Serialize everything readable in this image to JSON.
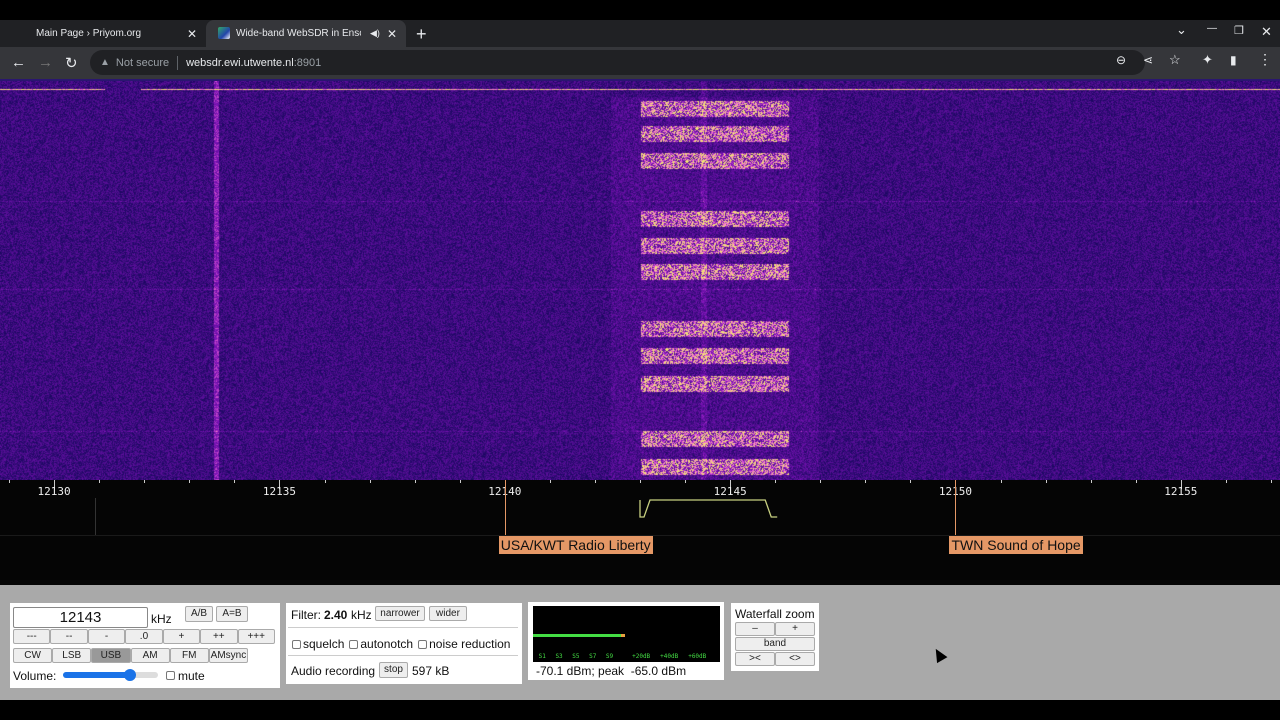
{
  "browser": {
    "tabs": [
      {
        "title": "Main Page › Priyom.org",
        "active": false
      },
      {
        "title": "Wide-band WebSDR in Enschede",
        "active": true,
        "audio": true
      }
    ],
    "new_tab_label": "+",
    "url": {
      "security": "Not secure",
      "host": "websdr.ewi.utwente.nl",
      "port": ":8901"
    },
    "icons": {
      "back": "←",
      "forward": "→",
      "reload": "↻",
      "zoom": "⊖",
      "share": "⋖",
      "star": "☆",
      "extensions": "✦",
      "sidepanel": "▮",
      "menu": "⋮",
      "tabsearch": "⌄",
      "minimize": "—",
      "restore": "❐",
      "close": "✕",
      "tabclose": "✕",
      "audio": "🔈"
    }
  },
  "scale": {
    "unit": "kHz",
    "range_khz": [
      12128.8,
      12157.2
    ],
    "major_ticks": [
      12130,
      12135,
      12140,
      12145,
      12150,
      12155
    ],
    "tick_labels": [
      "12130",
      "12135",
      "12140",
      "12145",
      "12150",
      "12155"
    ],
    "passband_khz": [
      12143.0,
      12146.0
    ]
  },
  "stations": [
    {
      "name": "USA/KWT Radio Liberty",
      "freq_khz": 12140
    },
    {
      "name": "TWN Sound of Hope",
      "freq_khz": 12150
    }
  ],
  "frequency": {
    "value": "12143",
    "unit": "kHz",
    "ab_label": "A/B",
    "aeqb_label": "A=B"
  },
  "step_buttons": [
    "---",
    "--",
    "-",
    ".0",
    "+",
    "++",
    "+++"
  ],
  "mode_buttons": [
    "CW",
    "LSB",
    "USB",
    "AM",
    "FM",
    "AMsync"
  ],
  "active_mode": "USB",
  "volume": {
    "label": "Volume:",
    "level": 0.7,
    "mute_label": "mute",
    "muted": false
  },
  "filter": {
    "label": "Filter:",
    "value": "2.40",
    "unit": "kHz",
    "narrower": "narrower",
    "wider": "wider"
  },
  "options": [
    {
      "label": "squelch",
      "checked": false
    },
    {
      "label": "autonotch",
      "checked": false
    },
    {
      "label": "noise reduction",
      "checked": false
    }
  ],
  "recording": {
    "label": "Audio recording",
    "stop": "stop",
    "size": "597 kB"
  },
  "smeter": {
    "labels": [
      "S1",
      "S3",
      "S5",
      "S7",
      "S9",
      "+20dB",
      "+40dB",
      "+60dB"
    ],
    "level_fraction": 0.47,
    "readout": "-70.1 dBm; peak  -65.0 dBm"
  },
  "waterfall_zoom": {
    "title": "Waterfall zoom",
    "minus": "–",
    "plus": "+",
    "band": "band",
    "narrow": "><",
    "wide": "<>"
  },
  "colors": {
    "waterfall_bg": "#1e0a6e",
    "station_label": "#e59866",
    "passband": "#c8d080",
    "meter": "#44dd44"
  }
}
